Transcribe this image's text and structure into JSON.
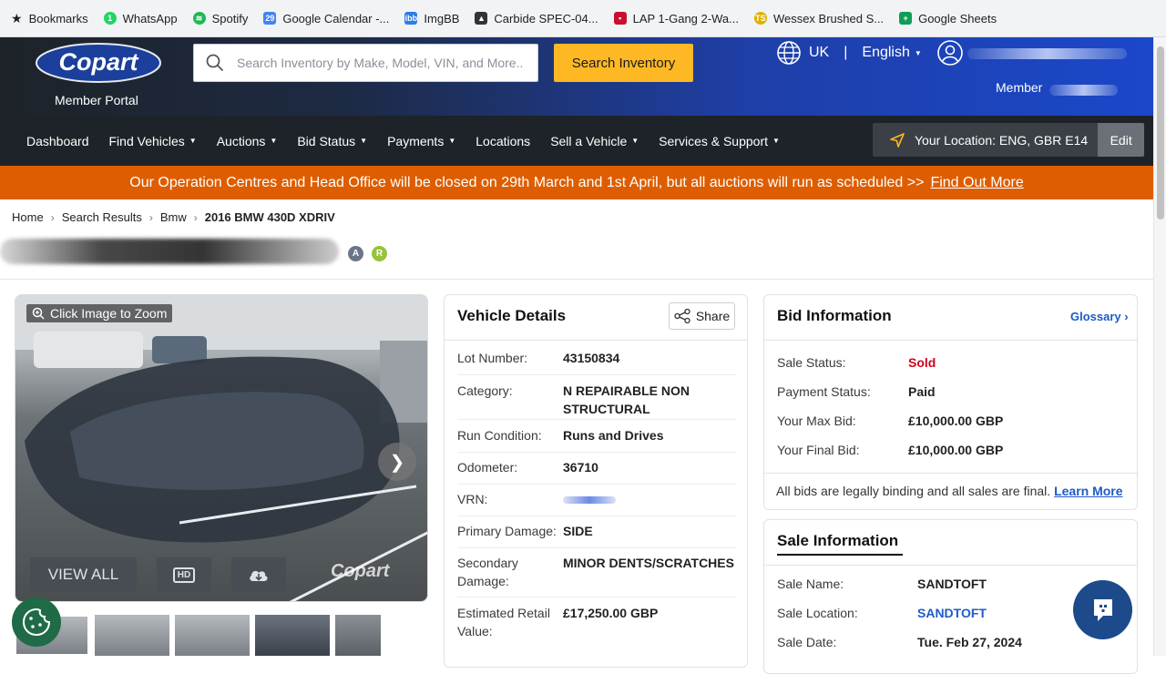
{
  "bookmarks": [
    {
      "label": "Bookmarks",
      "icon": "star-icon",
      "color": "#202124"
    },
    {
      "label": "WhatsApp",
      "icon": "whatsapp-icon",
      "color": "#25d366"
    },
    {
      "label": "Spotify",
      "icon": "spotify-icon",
      "color": "#1db954"
    },
    {
      "label": "Google Calendar -...",
      "icon": "calendar-icon",
      "color": "#4285f4"
    },
    {
      "label": "ImgBB",
      "icon": "imgbb-icon",
      "color": "#2b7de9"
    },
    {
      "label": "Carbide SPEC-04...",
      "icon": "carbide-icon",
      "color": "#333333"
    },
    {
      "label": "LAP 1-Gang 2-Wa...",
      "icon": "lap-icon",
      "color": "#c8102e"
    },
    {
      "label": "Wessex Brushed S...",
      "icon": "wessex-icon",
      "color": "#e0b000"
    },
    {
      "label": "Google Sheets",
      "icon": "sheets-icon",
      "color": "#0f9d58"
    }
  ],
  "header": {
    "logo_text": "Copart",
    "portal_label": "Member Portal",
    "search_placeholder": "Search Inventory by Make, Model, VIN, and More..",
    "search_button": "Search Inventory",
    "region": "UK",
    "separator": "|",
    "language": "English",
    "member_label": "Member"
  },
  "nav": {
    "items": [
      {
        "label": "Dashboard",
        "dropdown": false
      },
      {
        "label": "Find Vehicles",
        "dropdown": true
      },
      {
        "label": "Auctions",
        "dropdown": true
      },
      {
        "label": "Bid Status",
        "dropdown": true
      },
      {
        "label": "Payments",
        "dropdown": true
      },
      {
        "label": "Locations",
        "dropdown": false
      },
      {
        "label": "Sell a Vehicle",
        "dropdown": true
      },
      {
        "label": "Services & Support",
        "dropdown": true
      }
    ],
    "location_text": "Your Location: ENG, GBR E14",
    "edit_label": "Edit"
  },
  "banner": {
    "text": "Our Operation Centres and Head Office will be closed on 29th March and 1st April, but all auctions will run as scheduled >>",
    "link": "Find Out More"
  },
  "breadcrumb": [
    "Home",
    "Search Results",
    "Bmw",
    "2016 BMW 430D XDRIV"
  ],
  "badges": [
    "A",
    "R"
  ],
  "gallery": {
    "zoom_label": "Click Image to Zoom",
    "view_all": "VIEW ALL",
    "hd_label": "HD",
    "watermark": "Copart"
  },
  "vehicle_details": {
    "title": "Vehicle Details",
    "share_label": "Share",
    "rows": [
      {
        "label": "Lot Number:",
        "value": "43150834"
      },
      {
        "label": "Category:",
        "value": "N REPAIRABLE NON STRUCTURAL"
      },
      {
        "label": "Run Condition:",
        "value": "Runs and Drives"
      },
      {
        "label": "Odometer:",
        "value": "36710"
      },
      {
        "label": "VRN:",
        "value": ""
      },
      {
        "label": "Primary Damage:",
        "value": "SIDE"
      },
      {
        "label": "Secondary Damage:",
        "value": "MINOR DENTS/SCRATCHES"
      },
      {
        "label": "Estimated Retail Value:",
        "value": "£17,250.00 GBP"
      }
    ]
  },
  "bid_information": {
    "title": "Bid Information",
    "glossary": "Glossary",
    "rows": [
      {
        "label": "Sale Status:",
        "value": "Sold",
        "color": "#d0021b"
      },
      {
        "label": "Payment Status:",
        "value": "Paid",
        "color": "#222222"
      },
      {
        "label": "Your Max Bid:",
        "value": "£10,000.00 GBP",
        "color": "#222222"
      },
      {
        "label": "Your Final Bid:",
        "value": "£10,000.00 GBP",
        "color": "#222222"
      }
    ],
    "note": "All bids are legally binding and all sales are final.",
    "note_link": "Learn More"
  },
  "sale_information": {
    "title": "Sale Information",
    "rows": [
      {
        "label": "Sale Name:",
        "value": "SANDTOFT",
        "color": "#222222"
      },
      {
        "label": "Sale Location:",
        "value": "SANDTOFT",
        "color": "#1d5bc7"
      },
      {
        "label": "Sale Date:",
        "value": "Tue. Feb 27, 2024",
        "color": "#222222"
      }
    ]
  },
  "colors": {
    "accent": "#fdb824",
    "banner": "#de5d00",
    "link": "#1d5bc7",
    "sold": "#d0021b"
  }
}
